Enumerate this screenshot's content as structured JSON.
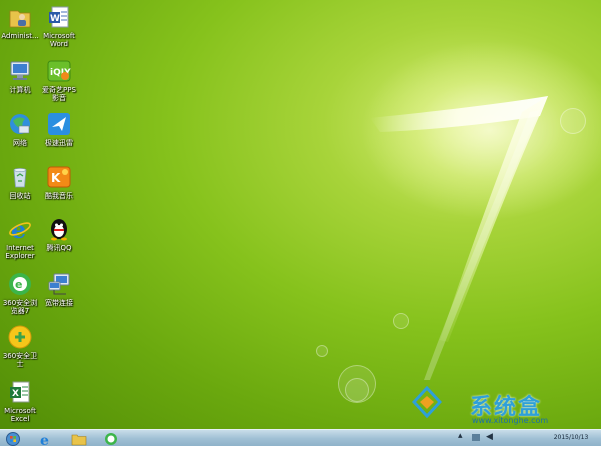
{
  "desktop": {
    "icons": [
      {
        "label": "Administ...",
        "icon": "folder-user-icon"
      },
      {
        "label": "Microsoft Word",
        "icon": "word-icon"
      },
      {
        "label": "计算机",
        "icon": "computer-icon"
      },
      {
        "label": "爱奇艺PPS 影音",
        "icon": "iqiyi-pps-icon"
      },
      {
        "label": "网络",
        "icon": "network-icon"
      },
      {
        "label": "极速迅雷",
        "icon": "xunlei-icon"
      },
      {
        "label": "回收站",
        "icon": "recycle-bin-icon"
      },
      {
        "label": "酷我音乐",
        "icon": "kuwo-icon"
      },
      {
        "label": "Internet Explorer",
        "icon": "ie-icon"
      },
      {
        "label": "腾讯QQ",
        "icon": "qq-icon"
      },
      {
        "label": "360安全浏览器7",
        "icon": "360-browser-icon"
      },
      {
        "label": "宽带连接",
        "icon": "broadband-icon"
      },
      {
        "label": "360安全卫士",
        "icon": "360-security-icon"
      },
      {
        "label": "Microsoft Excel",
        "icon": "excel-icon"
      }
    ]
  },
  "watermark": {
    "text": "系统盒",
    "url": "www.xitonghe.com"
  },
  "taskbar": {
    "clock": "2015/10/13",
    "apps": [
      "ie-icon",
      "folder-icon",
      "360-browser-icon"
    ]
  },
  "colors": {
    "wallpaper": "#86c21c",
    "taskbar": "#a8c6d9"
  }
}
